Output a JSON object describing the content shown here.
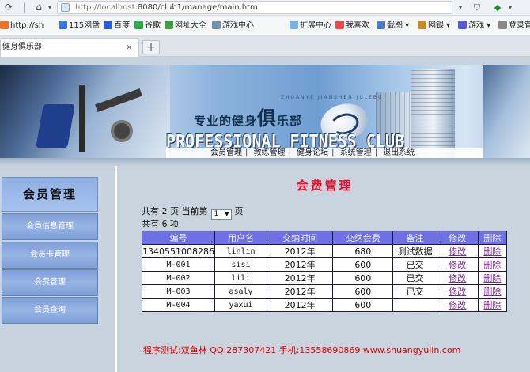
{
  "browser": {
    "url_host": "http://localhost",
    "url_rest": ":8080/club1/manage/main.htm",
    "bookmarks": [
      "http://sh",
      "115网盘",
      "百度",
      "谷歌",
      "网址大全",
      "游戏中心",
      "扩展中心",
      "我喜欢",
      "截图",
      "网银",
      "游戏",
      "登录管"
    ],
    "tab_title": "健身俱乐部",
    "new_tab": "+"
  },
  "banner": {
    "slogan_a": "专业的健身",
    "slogan_big": "俱",
    "slogan_b": "乐部",
    "pinyin": "ZHUANYE JIANSHEN JULEBU",
    "english": "PROFESSIONAL FITNESS CLUB",
    "nav": [
      "会员管理",
      "教练管理",
      "健身论坛",
      "系统管理",
      "退出系统"
    ]
  },
  "sidebar": {
    "title": "会员管理",
    "items": [
      "会员信息管理",
      "会员卡管理",
      "会费管理",
      "会员查询"
    ]
  },
  "main": {
    "title": "会费管理",
    "pager": {
      "prefix": "共有",
      "pages": "2",
      "pages_suffix": "页 当前第",
      "current": "1",
      "suffix": "页"
    },
    "total": "共有 6 项",
    "columns": [
      "编号",
      "用户名",
      "交纳时间",
      "交纳会费",
      "备注",
      "修改",
      "删除"
    ],
    "rows": [
      [
        "1340551008286",
        "linlin",
        "2012年",
        "680",
        "测试数据",
        "修改",
        "删除"
      ],
      [
        "M-001",
        "sisi",
        "2012年",
        "600",
        "已交",
        "修改",
        "删除"
      ],
      [
        "M-002",
        "lili",
        "2012年",
        "600",
        "已交",
        "修改",
        "删除"
      ],
      [
        "M-003",
        "asaly",
        "2012年",
        "600",
        "已交",
        "修改",
        "删除"
      ],
      [
        "M-004",
        "yaxui",
        "2012年",
        "600",
        "",
        "修改",
        "删除"
      ]
    ]
  },
  "footer": "程序测试:双鱼林 QQ:287307421 手机:13558690869 www.shuangyulin.com"
}
